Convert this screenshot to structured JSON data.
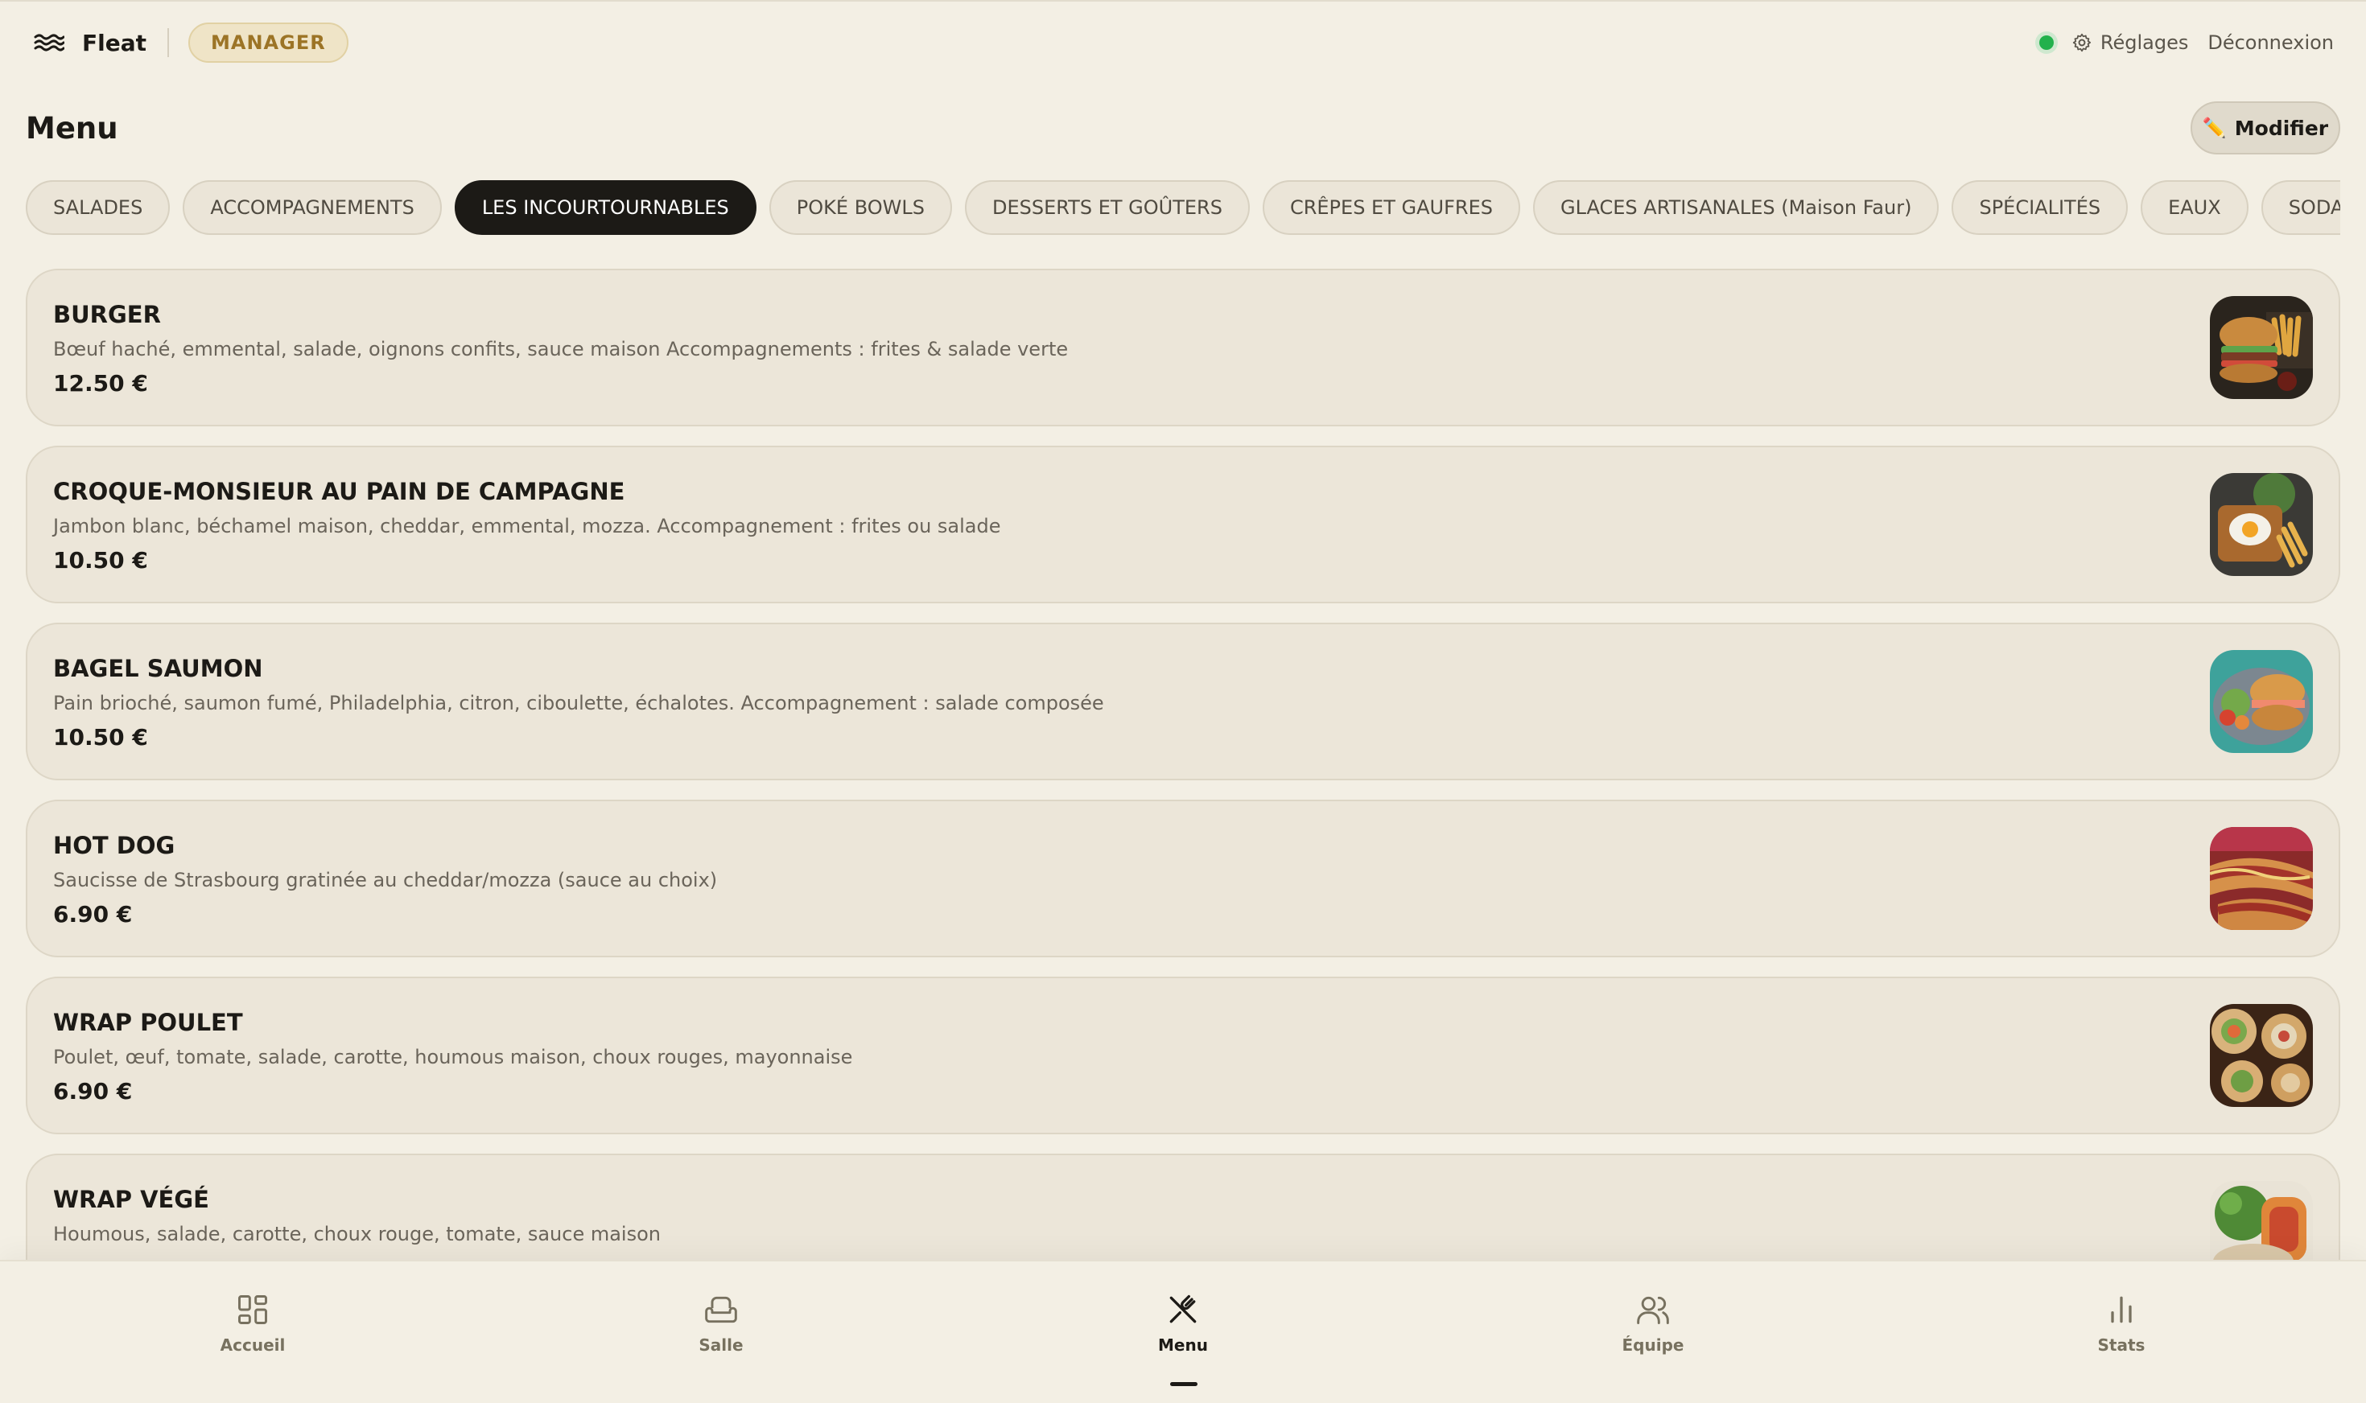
{
  "app": {
    "name": "Fleat",
    "role": "MANAGER",
    "status_color": "#22b14c",
    "settings_label": "Réglages",
    "logout_label": "Déconnexion"
  },
  "page": {
    "title": "Menu",
    "edit_label": "Modifier",
    "edit_icon": "✏️"
  },
  "tabs": [
    {
      "label": "SALADES",
      "active": false
    },
    {
      "label": "ACCOMPAGNEMENTS",
      "active": false
    },
    {
      "label": "LES INCOURTOURNABLES",
      "active": true
    },
    {
      "label": "POKÉ BOWLS",
      "active": false
    },
    {
      "label": "DESSERTS ET GOÛTERS",
      "active": false
    },
    {
      "label": "CRÊPES ET GAUFRES",
      "active": false
    },
    {
      "label": "GLACES ARTISANALES (Maison Faur)",
      "active": false
    },
    {
      "label": "SPÉCIALITÉS",
      "active": false
    },
    {
      "label": "EAUX",
      "active": false
    },
    {
      "label": "SODAS",
      "active": false
    }
  ],
  "items": [
    {
      "name": "BURGER",
      "description": "Bœuf haché, emmental, salade, oignons confits, sauce maison Accompagnements : frites & salade verte",
      "price": "12.50 €",
      "photo": "burger-photo"
    },
    {
      "name": "CROQUE-MONSIEUR AU PAIN DE CAMPAGNE",
      "description": "Jambon blanc, béchamel maison, cheddar, emmental, mozza. Accompagnement : frites ou salade",
      "price": "10.50 €",
      "photo": "croque-monsieur-photo"
    },
    {
      "name": "BAGEL SAUMON",
      "description": "Pain brioché, saumon fumé, Philadelphia, citron, ciboulette, échalotes. Accompagnement : salade composée",
      "price": "10.50 €",
      "photo": "bagel-photo"
    },
    {
      "name": "HOT DOG",
      "description": "Saucisse de Strasbourg gratinée au cheddar/mozza (sauce au choix)",
      "price": "6.90 €",
      "photo": "hot-dog-photo"
    },
    {
      "name": "WRAP POULET",
      "description": "Poulet, œuf, tomate, salade, carotte, houmous maison, choux rouges, mayonnaise",
      "price": "6.90 €",
      "photo": "wrap-photo"
    },
    {
      "name": "WRAP VÉGÉ",
      "description": "Houmous, salade, carotte, choux rouge, tomate, sauce maison",
      "price": "",
      "photo": "wrap-vege-photo"
    }
  ],
  "nav": [
    {
      "label": "Accueil",
      "icon": "grid-icon",
      "active": false
    },
    {
      "label": "Salle",
      "icon": "armchair-icon",
      "active": false
    },
    {
      "label": "Menu",
      "icon": "utensils-icon",
      "active": true
    },
    {
      "label": "Équipe",
      "icon": "users-icon",
      "active": false
    },
    {
      "label": "Stats",
      "icon": "bar-chart-icon",
      "active": false
    }
  ]
}
